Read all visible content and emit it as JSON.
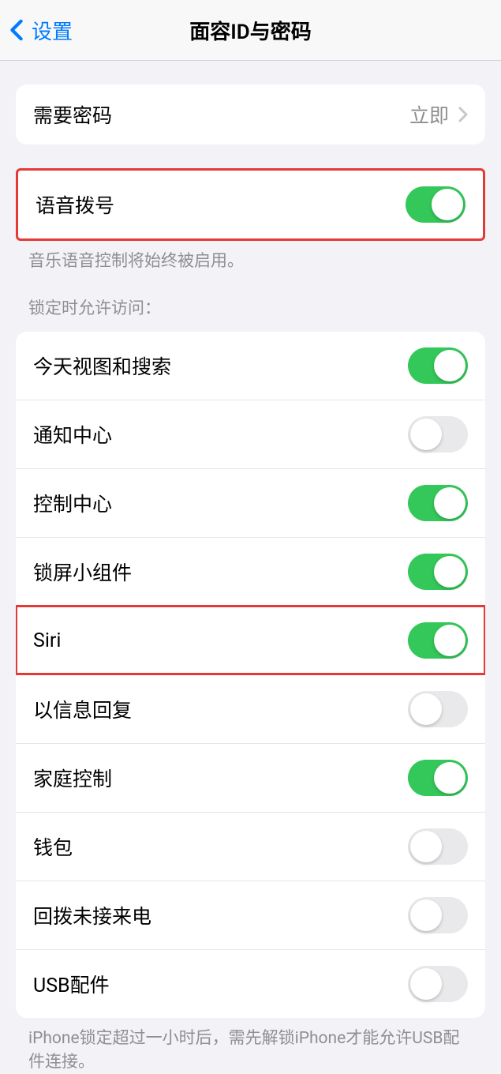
{
  "nav": {
    "back_label": "设置",
    "title": "面容ID与密码"
  },
  "passcode_group": {
    "require_passcode": {
      "label": "需要密码",
      "value": "立即"
    }
  },
  "voice_dial": {
    "label": "语音拨号",
    "on": true,
    "footer": "音乐语音控制将始终被启用。"
  },
  "lock_access": {
    "header": "锁定时允许访问：",
    "items": [
      {
        "label": "今天视图和搜索",
        "on": true,
        "highlight": false
      },
      {
        "label": "通知中心",
        "on": false,
        "highlight": false
      },
      {
        "label": "控制中心",
        "on": true,
        "highlight": false
      },
      {
        "label": "锁屏小组件",
        "on": true,
        "highlight": false
      },
      {
        "label": "Siri",
        "on": true,
        "highlight": true
      },
      {
        "label": "以信息回复",
        "on": false,
        "highlight": false
      },
      {
        "label": "家庭控制",
        "on": true,
        "highlight": false
      },
      {
        "label": "钱包",
        "on": false,
        "highlight": false
      },
      {
        "label": "回拨未接来电",
        "on": false,
        "highlight": false
      },
      {
        "label": "USB配件",
        "on": false,
        "highlight": false
      }
    ],
    "footer": "iPhone锁定超过一小时后，需先解锁iPhone才能允许USB配件连接。"
  }
}
